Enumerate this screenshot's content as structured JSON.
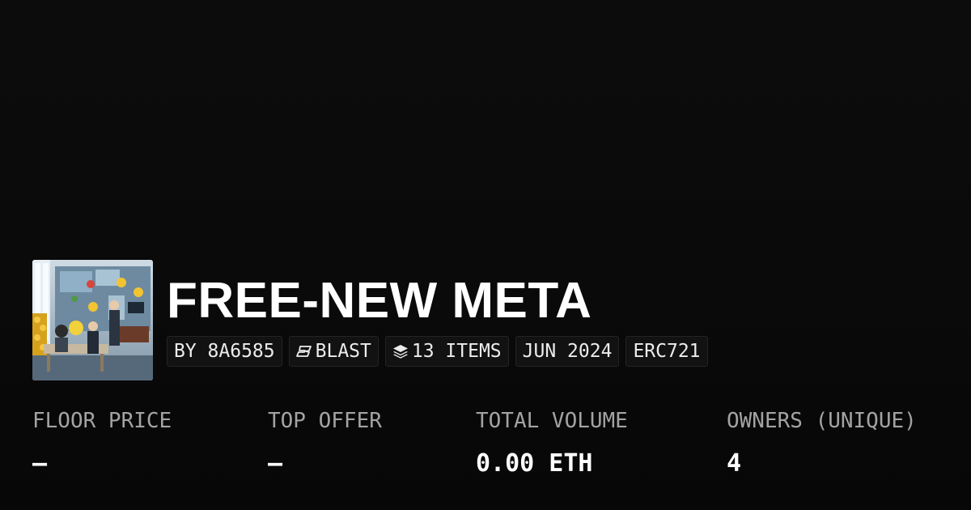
{
  "collection": {
    "title": "FREE-NEW META",
    "thumbnail_icon": "collection-artwork"
  },
  "tags": {
    "creator": "BY 8A6585",
    "chain_icon": "blast-logo-icon",
    "chain": "BLAST",
    "items_icon": "layers-icon",
    "items": "13 ITEMS",
    "date": "JUN 2024",
    "standard": "ERC721"
  },
  "stats": {
    "floor_price": {
      "label": "FLOOR PRICE",
      "value": "—"
    },
    "top_offer": {
      "label": "TOP OFFER",
      "value": "—"
    },
    "total_volume": {
      "label": "TOTAL VOLUME",
      "value": "0.00 ETH"
    },
    "owners": {
      "label": "OWNERS (UNIQUE)",
      "value": "4"
    }
  },
  "colors": {
    "background": "#0a0a0a",
    "tag_background": "#121212",
    "tag_border": "#242424",
    "label": "#a3a3a3",
    "value": "#ffffff"
  }
}
